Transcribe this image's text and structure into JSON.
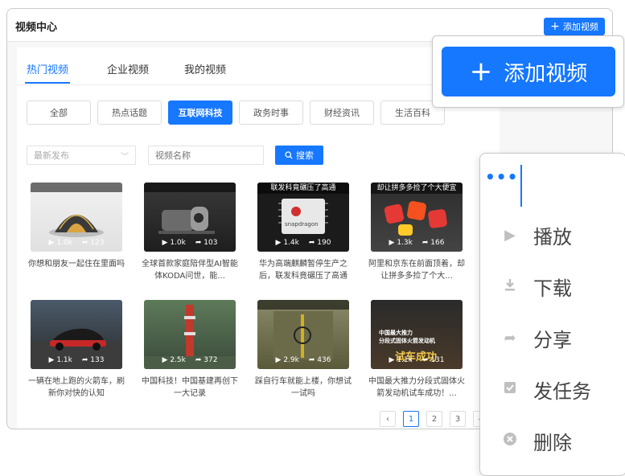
{
  "header": {
    "title": "视频中心",
    "add_button_label": "添加视频"
  },
  "tabs": [
    {
      "label": "热门视频",
      "active": true
    },
    {
      "label": "企业视频",
      "active": false
    },
    {
      "label": "我的视频",
      "active": false
    }
  ],
  "categories": [
    {
      "label": "全部",
      "active": false
    },
    {
      "label": "热点话题",
      "active": false
    },
    {
      "label": "互联网科技",
      "active": true
    },
    {
      "label": "政务时事",
      "active": false
    },
    {
      "label": "财经资讯",
      "active": false
    },
    {
      "label": "生活百科",
      "active": false
    }
  ],
  "filters": {
    "sort_placeholder": "最新发布",
    "name_placeholder": "视频名称",
    "search_label": "搜索"
  },
  "videos": [
    {
      "title": "你想和朋友一起住在里面吗",
      "plays": "1.0k",
      "shares": "123",
      "overlay": ""
    },
    {
      "title": "全球首款家庭陪伴型AI智能体KODA问世，能...",
      "plays": "1.0k",
      "shares": "103",
      "overlay": ""
    },
    {
      "title": "华为高端麒麟暂停生产之后，联发科竟碾压了高通",
      "plays": "1.4k",
      "shares": "190",
      "overlay": "联发科竟碾压了高通"
    },
    {
      "title": "阿里和京东在前面顶着，却让拼多多捡了个大...",
      "plays": "1.3k",
      "shares": "166",
      "overlay": "却让拼多多捡了个大便宜"
    },
    {
      "title": "一辆在地上跑的火箭车，刷新你对快的认知",
      "plays": "1.1k",
      "shares": "133",
      "overlay": ""
    },
    {
      "title": "中国科技！中国基建再创下一大记录",
      "plays": "2.5k",
      "shares": "372",
      "overlay": ""
    },
    {
      "title": "踩自行车就能上楼，你想试一试吗",
      "plays": "2.9k",
      "shares": "436",
      "overlay": ""
    },
    {
      "title": "中国最大推力分段式固体火箭发动机试车成功！...",
      "plays": "1.1k",
      "shares": "131",
      "overlay": "试车成功"
    }
  ],
  "thumb_texts": {
    "rocket_line1": "中国最大推力",
    "rocket_line2": "分段式固体火箭发动机",
    "snapdragon": "snapdragon"
  },
  "pagination": {
    "pages": [
      "1",
      "2",
      "3",
      "4"
    ],
    "current": "1",
    "prev": "‹"
  },
  "zoom": {
    "add_button_label": "添加视频"
  },
  "menu": {
    "trigger": "•••",
    "items": [
      {
        "label": "播放",
        "icon": "play-icon"
      },
      {
        "label": "下载",
        "icon": "download-icon"
      },
      {
        "label": "分享",
        "icon": "share-icon"
      },
      {
        "label": "发任务",
        "icon": "task-icon"
      },
      {
        "label": "删除",
        "icon": "delete-icon"
      }
    ]
  },
  "colors": {
    "accent": "#1677ff",
    "panel_bg": "#f7f7f7",
    "icon_gray": "#bfbfbf"
  }
}
